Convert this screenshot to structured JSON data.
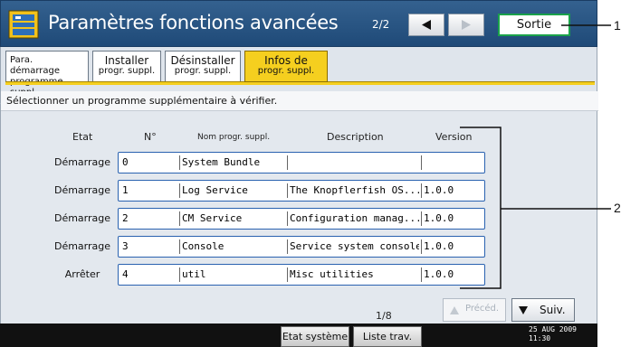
{
  "header": {
    "title": "Paramètres fonctions avancées",
    "page_indicator": "2/2",
    "prev_icon": "triangle-left-icon",
    "next_icon": "triangle-right-icon",
    "exit_label": "Sortie"
  },
  "tabs": [
    {
      "line1": "Para. démarrage",
      "line2": "programme suppl."
    },
    {
      "line1": "Installer",
      "line2": "progr. suppl."
    },
    {
      "line1": "Désinstaller",
      "line2": "progr. suppl."
    },
    {
      "line1": "Infos de",
      "line2": "progr. suppl.",
      "active": true
    }
  ],
  "instruction": "Sélectionner un programme supplémentaire à vérifier.",
  "table": {
    "columns": [
      "Etat",
      "N°",
      "Nom progr. suppl.",
      "Description",
      "Version"
    ],
    "rows": [
      {
        "state": "Démarrage",
        "no": "0",
        "name": "System Bundle",
        "description": "",
        "version": ""
      },
      {
        "state": "Démarrage",
        "no": "1",
        "name": "Log Service",
        "description": "The Knopflerfish OS...",
        "version": "1.0.0"
      },
      {
        "state": "Démarrage",
        "no": "2",
        "name": "CM Service",
        "description": "Configuration manag...",
        "version": "1.0.0"
      },
      {
        "state": "Démarrage",
        "no": "3",
        "name": "Console",
        "description": "Service system console",
        "version": "1.0.0"
      },
      {
        "state": "Arrêter",
        "no": "4",
        "name": "util",
        "description": "Misc utilities",
        "version": "1.0.0"
      }
    ]
  },
  "pagination": {
    "count": "1/8",
    "prev_label": "Précéd.",
    "next_label": "Suiv."
  },
  "footer": {
    "system_status_label": "Etat système",
    "job_list_label": "Liste trav.",
    "date": "25 AUG  2009",
    "time": "11:30"
  },
  "callouts": [
    "1",
    "2"
  ],
  "colors": {
    "title_bar": "#2b5885",
    "active_tab": "#f5cf1f",
    "exit_border": "#1aa24a",
    "row_border": "#2a62b0"
  }
}
